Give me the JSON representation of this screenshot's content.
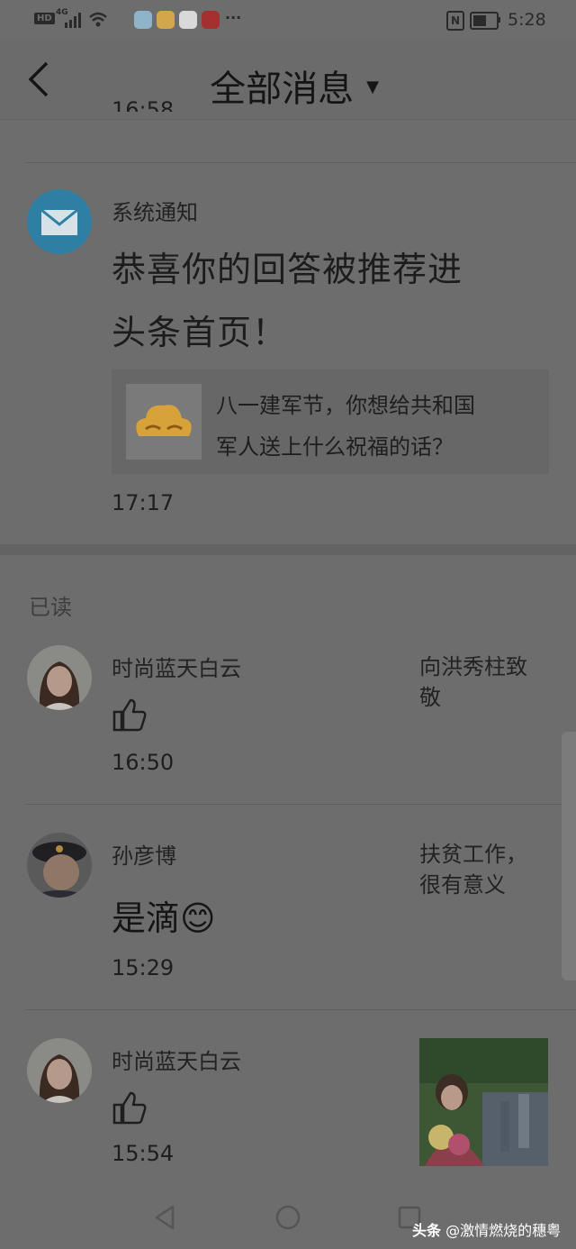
{
  "status_bar": {
    "left_indicators": [
      "HD",
      "4G"
    ],
    "apps": [
      "browser-icon",
      "mail-icon",
      "news-icon",
      "red-app-icon"
    ],
    "more": "···",
    "nfc": "N",
    "time": "5:28"
  },
  "header": {
    "title": "全部消息",
    "partial_time": "16:58"
  },
  "system_notice": {
    "sender": "系统通知",
    "title_line1": "恭喜你的回答被推荐进",
    "title_line2": "头条首页！",
    "quote_line1": "八一建军节，你想给共和国",
    "quote_line2": "军人送上什么祝福的话？",
    "time": "17:17"
  },
  "read_section": {
    "label": "已读",
    "items": [
      {
        "name": "时尚蓝天白云",
        "content_icon": "thumbs-up-icon",
        "time": "16:50",
        "ref_line1": "向洪秀柱致",
        "ref_line2": "敬"
      },
      {
        "name": "孙彦博",
        "content": "是滴",
        "emoji": "😊",
        "time": "15:29",
        "ref_line1": "扶贫工作，",
        "ref_line2": "很有意义"
      },
      {
        "name": "时尚蓝天白云",
        "content_icon": "thumbs-up-icon",
        "time": "15:54"
      }
    ]
  },
  "watermark": {
    "prefix": "头条",
    "handle": "@激情燃烧的穗粤"
  },
  "colors": {
    "overlay_gray": "#6d6d6d",
    "mail_blue": "#2f7fa4",
    "badge_gold": "#d8a23a"
  }
}
